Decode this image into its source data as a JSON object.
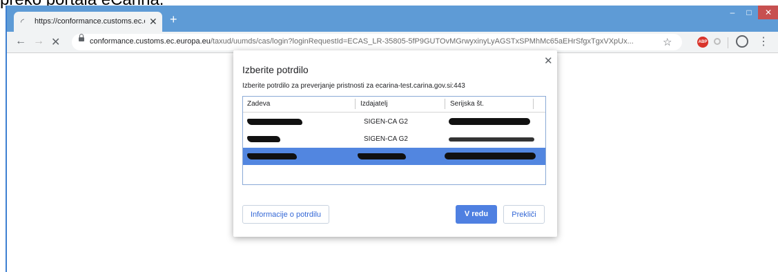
{
  "doc_heading": "preko portala eCarina.",
  "browser": {
    "tab_title": "https://conformance.customs.ec.europa.eu/taxud/uumds/cas/login",
    "tab_close": "✕",
    "new_tab": "+",
    "window_controls": {
      "minimize": "–",
      "maximize": "□",
      "close": "✕"
    },
    "nav": {
      "back": "←",
      "forward": "→",
      "stop": "✕"
    },
    "url_host": "conformance.customs.ec.europa.eu",
    "url_path": "/taxud/uumds/cas/login?loginRequestId=ECAS_LR-35805-5fP9GUTOvMGrwyxinyLyAGSTxSPMhMc65aEHrSfgxTgxVXpUx...",
    "bookmark_star": "☆",
    "ext_abp": "ABP",
    "menu_dots": "⋮"
  },
  "dialog": {
    "title": "Izberite potrdilo",
    "subtitle": "Izberite potrdilo za preverjanje pristnosti za ecarina-test.carina.gov.si:443",
    "close_icon": "✕",
    "columns": [
      "Zadeva",
      "Izdajatelj",
      "Serijska št."
    ],
    "rows": [
      {
        "issuer": "SIGEN-CA G2",
        "selected": false
      },
      {
        "issuer": "SIGEN-CA G2",
        "selected": false
      },
      {
        "issuer": "",
        "selected": true
      }
    ],
    "buttons": {
      "info": "Informacije o potrdilu",
      "ok": "V redu",
      "cancel": "Prekliči"
    }
  },
  "colors": {
    "titlebar": "#5e9bd6",
    "selection": "#5286e0",
    "primary_button": "#4f80e1",
    "close_button": "#c75050"
  }
}
